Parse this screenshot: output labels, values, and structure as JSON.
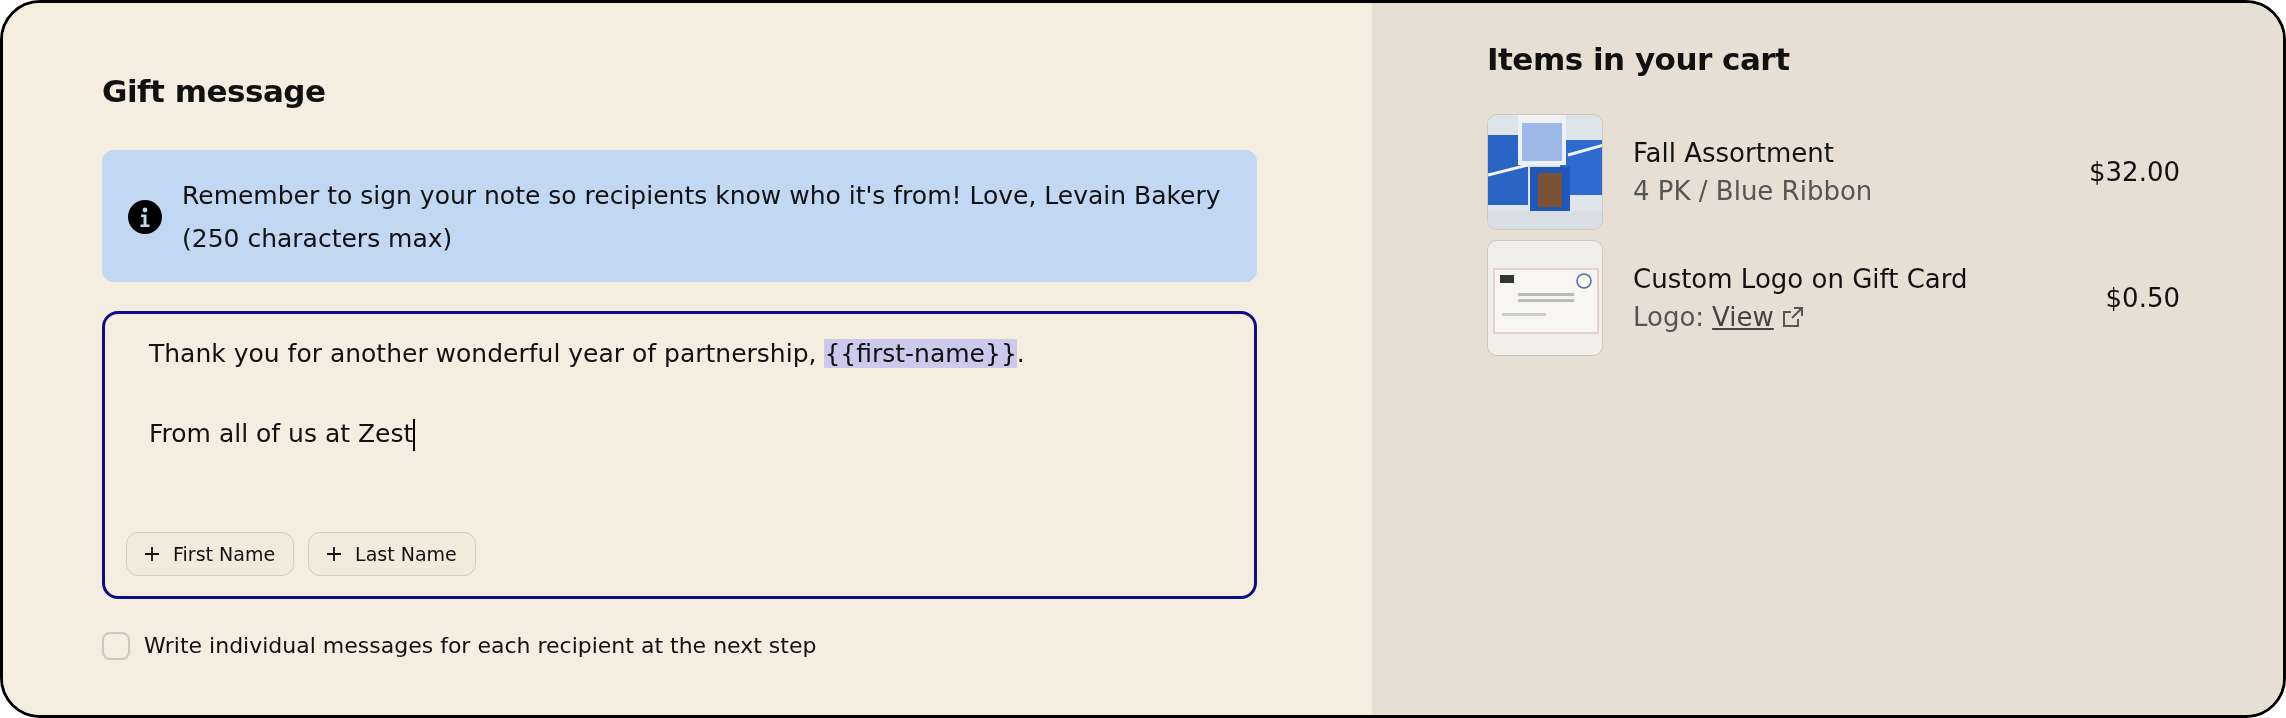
{
  "gift_message": {
    "title": "Gift message",
    "notice": "Remember to sign your note so recipients know who it's from! Love, Levain Bakery (250 characters max)",
    "message_lines": [
      {
        "segments": [
          {
            "kind": "text",
            "text": "Thank you for another wonderful year of partnership, "
          },
          {
            "kind": "token",
            "text": "{{first-name}}"
          },
          {
            "kind": "text",
            "text": "."
          }
        ],
        "caret": false
      },
      {
        "segments": [
          {
            "kind": "text",
            "text": "From all of us at Zest"
          }
        ],
        "caret": true
      }
    ],
    "focused": true,
    "insert_buttons": [
      "First Name",
      "Last Name"
    ],
    "individual_messages": {
      "label": "Write individual messages for each recipient at the next step",
      "checked": false
    }
  },
  "cart": {
    "title": "Items in your cart",
    "items": [
      {
        "name": "Fall Assortment",
        "detail": "4 PK / Blue Ribbon",
        "price": "$32.00",
        "kind": "variant"
      },
      {
        "name": "Custom Logo on Gift Card",
        "detail": "Logo:",
        "link": "View",
        "price": "$0.50",
        "kind": "link"
      }
    ]
  }
}
